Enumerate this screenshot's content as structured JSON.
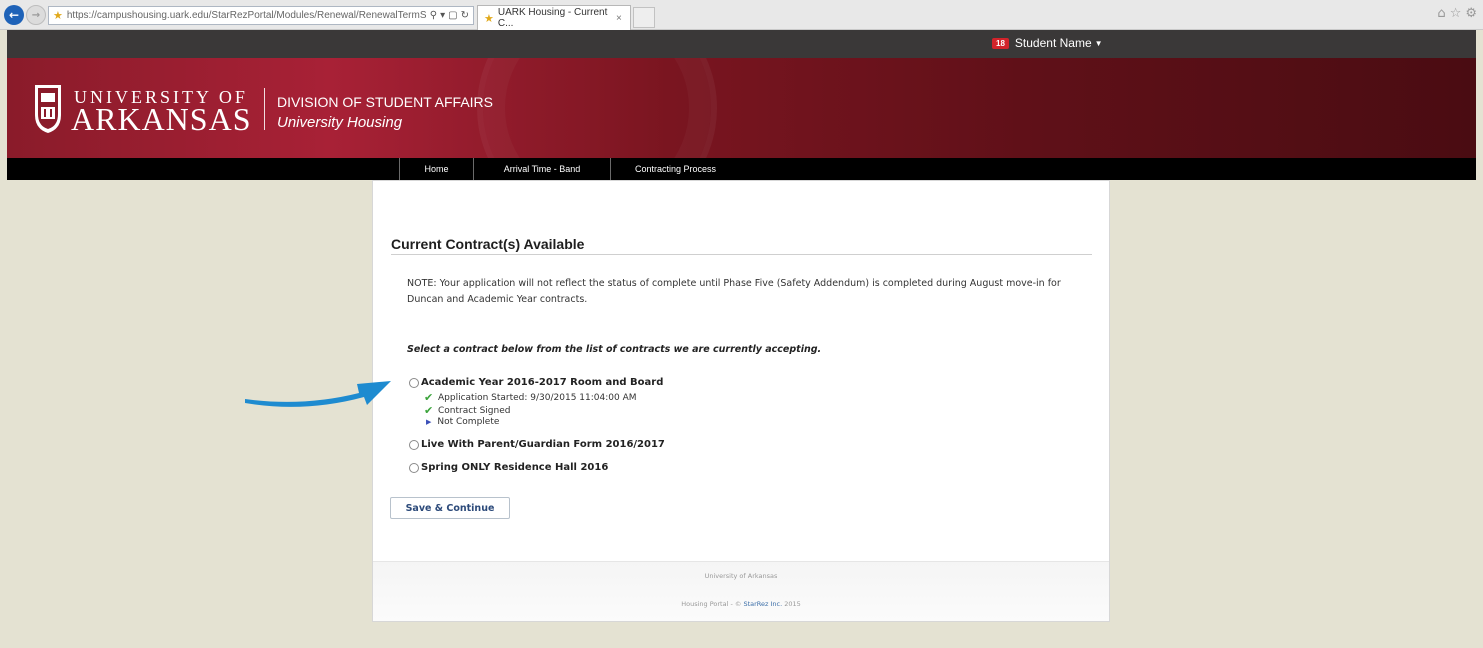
{
  "browser": {
    "url": "https://campushousing.uark.edu/StarRezPortal/Modules/Renewal/RenewalTermSele",
    "tab_title": "UARK Housing - Current C...",
    "tab_close": "×",
    "back_icon": "back-arrow-icon",
    "forward_icon": "forward-arrow-icon",
    "addr_tools": [
      "search-icon",
      "dropdown-icon",
      "lock-icon",
      "refresh-icon"
    ],
    "right_icons": [
      "home-icon",
      "favorites-star-icon",
      "settings-gear-icon"
    ]
  },
  "user": {
    "badge": "18",
    "name": "Student Name"
  },
  "banner": {
    "university_line1": "UNIVERSITY OF",
    "university_line2": "ARKANSAS",
    "division": "DIVISION OF STUDENT AFFAIRS",
    "subdivision": "University Housing"
  },
  "nav": {
    "items": [
      {
        "label": "Home"
      },
      {
        "label": "Arrival Time - Band"
      },
      {
        "label": "Contracting Process"
      }
    ]
  },
  "main": {
    "title": "Current Contract(s) Available",
    "note": "NOTE: Your application will not reflect the status of complete until Phase Five (Safety Addendum) is completed during August move-in for Duncan and Academic Year contracts.",
    "instruction": "Select a contract below from the list of contracts we are currently accepting.",
    "contracts": [
      {
        "label": "Academic Year 2016-2017 Room and Board",
        "status": [
          {
            "icon": "check-icon",
            "text": "Application Started: 9/30/2015 11:04:00 AM"
          },
          {
            "icon": "check-icon",
            "text": "Contract Signed"
          },
          {
            "icon": "arrow-icon",
            "text": "Not Complete"
          }
        ]
      },
      {
        "label": "Live With Parent/Guardian Form 2016/2017"
      },
      {
        "label": "Spring ONLY Residence Hall 2016"
      }
    ],
    "save_button": "Save & Continue"
  },
  "footer": {
    "university": "University of Arkansas",
    "portal_prefix": "Housing Portal - © ",
    "portal_link": "StarRez Inc.",
    "portal_suffix": " 2015"
  },
  "colors": {
    "accent": "#9b1c2e",
    "annotation_arrow": "#1e8bd0",
    "check": "#3aa33a",
    "page_bg": "#e4e2d2"
  }
}
